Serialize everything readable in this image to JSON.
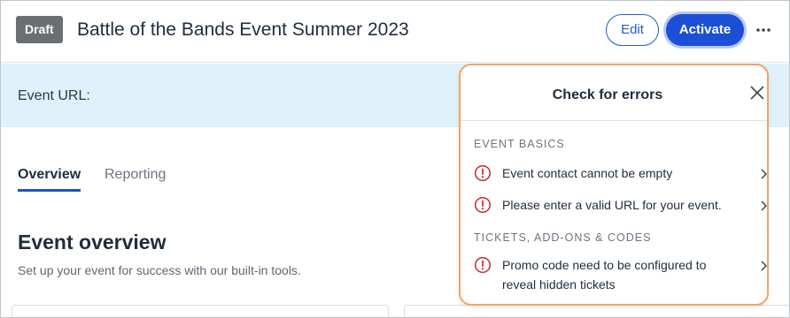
{
  "header": {
    "status_badge": "Draft",
    "title": "Battle of the Bands Event Summer 2023",
    "edit_label": "Edit",
    "activate_label": "Activate",
    "more_icon": "ellipsis-icon"
  },
  "url_band": {
    "label": "Event URL:"
  },
  "tabs": [
    {
      "label": "Overview",
      "active": true
    },
    {
      "label": "Reporting",
      "active": false
    }
  ],
  "overview": {
    "title": "Event overview",
    "subtitle": "Set up your event for success with our built-in tools."
  },
  "errors_panel": {
    "title": "Check for errors",
    "close_icon": "close-icon",
    "sections": [
      {
        "label": "EVENT BASICS",
        "items": [
          {
            "text": "Event contact cannot be empty"
          },
          {
            "text": "Please enter a valid URL for your event."
          }
        ]
      },
      {
        "label": "TICKETS, ADD-ONS & CODES",
        "items": [
          {
            "text": "Promo code need to be configured to reveal hidden tickets"
          }
        ]
      }
    ]
  },
  "colors": {
    "accent": "#1a4fd6",
    "error": "#c62828",
    "panel_border": "#f4a362",
    "url_band": "#dff2fb",
    "badge": "#6b6e73"
  }
}
